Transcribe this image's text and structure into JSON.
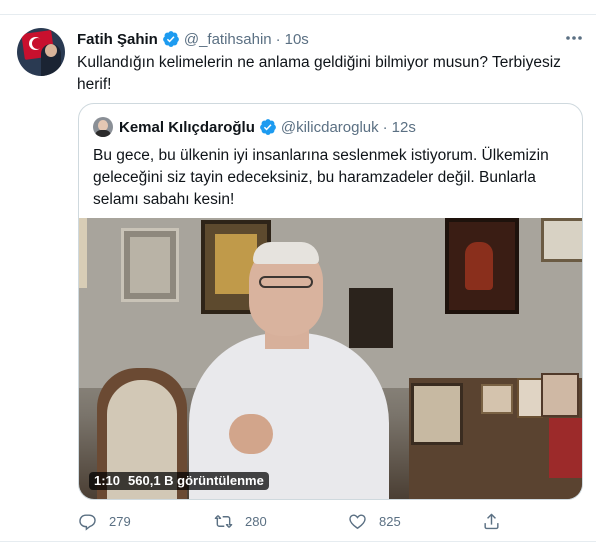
{
  "tweet": {
    "author_name": "Fatih Şahin",
    "author_handle": "@_fatihsahin",
    "separator": "·",
    "time": "10s",
    "text": "Kullandığın kelimelerin ne anlama geldiğini bilmiyor musun? Terbiyesiz herif!"
  },
  "quoted_tweet": {
    "author_name": "Kemal Kılıçdaroğlu",
    "author_handle": "@kilicdarogluk",
    "separator": "·",
    "time": "12s",
    "text": "Bu gece, bu ülkenin iyi insanlarına seslenmek istiyorum. Ülkemizin geleceğini siz tayin edeceksiniz, bu haramzadeler değil. Bunlarla selamı sabahı kesin!",
    "video": {
      "duration": "1:10",
      "views": "560,1 B görüntülenme"
    }
  },
  "actions": {
    "reply_count": "279",
    "retweet_count": "280",
    "like_count": "825"
  },
  "colors": {
    "accent": "#1d9bf0",
    "muted": "#5b7083"
  },
  "icons": [
    "verified-badge-icon",
    "more-icon",
    "reply-icon",
    "retweet-icon",
    "like-icon",
    "share-icon"
  ]
}
